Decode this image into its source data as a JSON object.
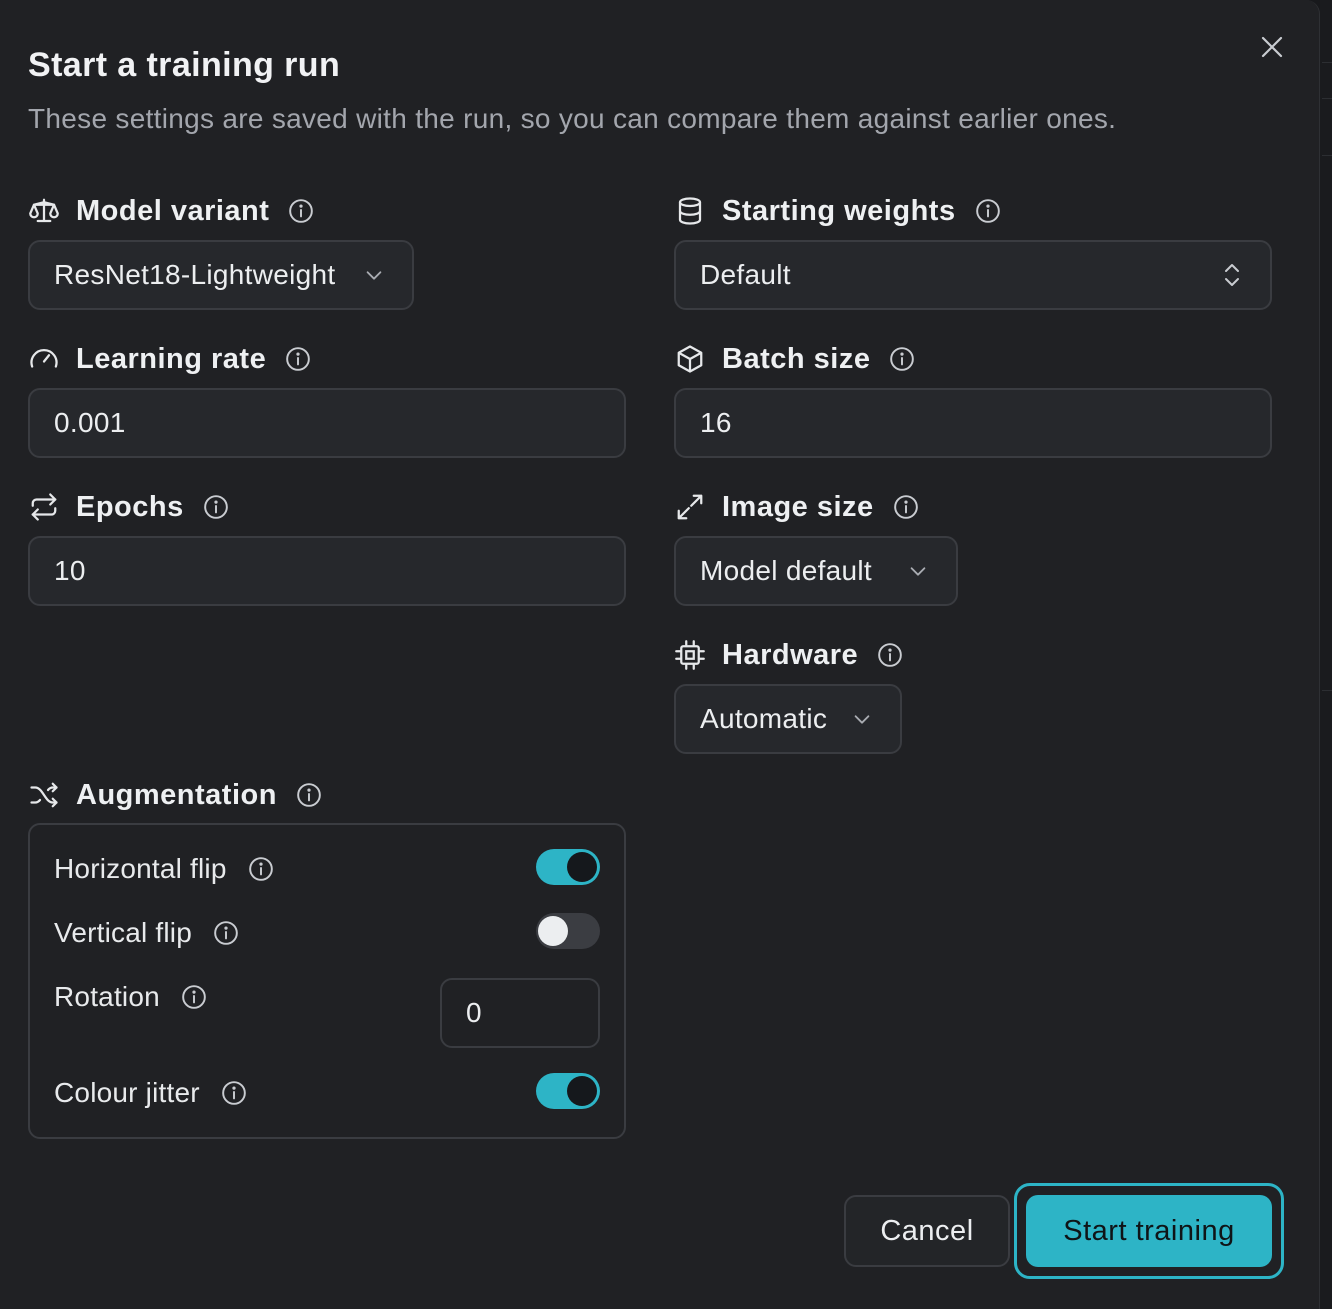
{
  "dialog": {
    "title": "Start a training run",
    "subtitle": "These settings are saved with the run, so you can compare them against earlier ones."
  },
  "fields": {
    "model_variant": {
      "label": "Model variant",
      "icon": "scale-icon",
      "value": "ResNet18-Lightweight"
    },
    "starting_weights": {
      "label": "Starting weights",
      "icon": "database-icon",
      "value": "Default"
    },
    "learning_rate": {
      "label": "Learning rate",
      "icon": "gauge-icon",
      "value": "0.001"
    },
    "batch_size": {
      "label": "Batch size",
      "icon": "cube-icon",
      "value": "16"
    },
    "epochs": {
      "label": "Epochs",
      "icon": "repeat-icon",
      "value": "10"
    },
    "image_size": {
      "label": "Image size",
      "icon": "expand-icon",
      "value": "Model default"
    },
    "hardware": {
      "label": "Hardware",
      "icon": "cpu-icon",
      "value": "Automatic"
    }
  },
  "augmentation": {
    "label": "Augmentation",
    "icon": "shuffle-icon",
    "horizontal_flip": {
      "label": "Horizontal flip",
      "enabled": true
    },
    "vertical_flip": {
      "label": "Vertical flip",
      "enabled": false
    },
    "rotation": {
      "label": "Rotation",
      "value": "0"
    },
    "colour_jitter": {
      "label": "Colour jitter",
      "enabled": true
    }
  },
  "actions": {
    "cancel": "Cancel",
    "start": "Start training"
  },
  "colors": {
    "accent": "#2db4c6",
    "background": "#202124",
    "field_border": "#3a3c41"
  }
}
